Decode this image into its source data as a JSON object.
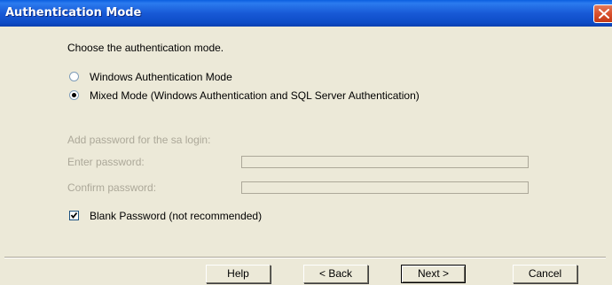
{
  "window": {
    "title": "Authentication Mode",
    "colors": {
      "background": "#ECE9D8",
      "title_bar": "#1859D6",
      "disabled_text": "#ACA899",
      "close_button": "#D9512E"
    }
  },
  "prompt": "Choose the authentication mode.",
  "auth_modes": [
    {
      "label": "Windows Authentication Mode",
      "selected": false
    },
    {
      "label": "Mixed Mode (Windows Authentication and SQL Server Authentication)",
      "selected": true
    }
  ],
  "sa_login": {
    "heading": "Add password for the sa login:",
    "enter_label": "Enter password:",
    "enter_value": "",
    "confirm_label": "Confirm password:",
    "confirm_value": ""
  },
  "blank_password": {
    "label": "Blank Password (not recommended)",
    "checked": true
  },
  "buttons": {
    "help": "Help",
    "back": "< Back",
    "next": "Next >",
    "cancel": "Cancel"
  },
  "icons": {
    "close": "close-icon",
    "check": "checkmark-icon"
  }
}
